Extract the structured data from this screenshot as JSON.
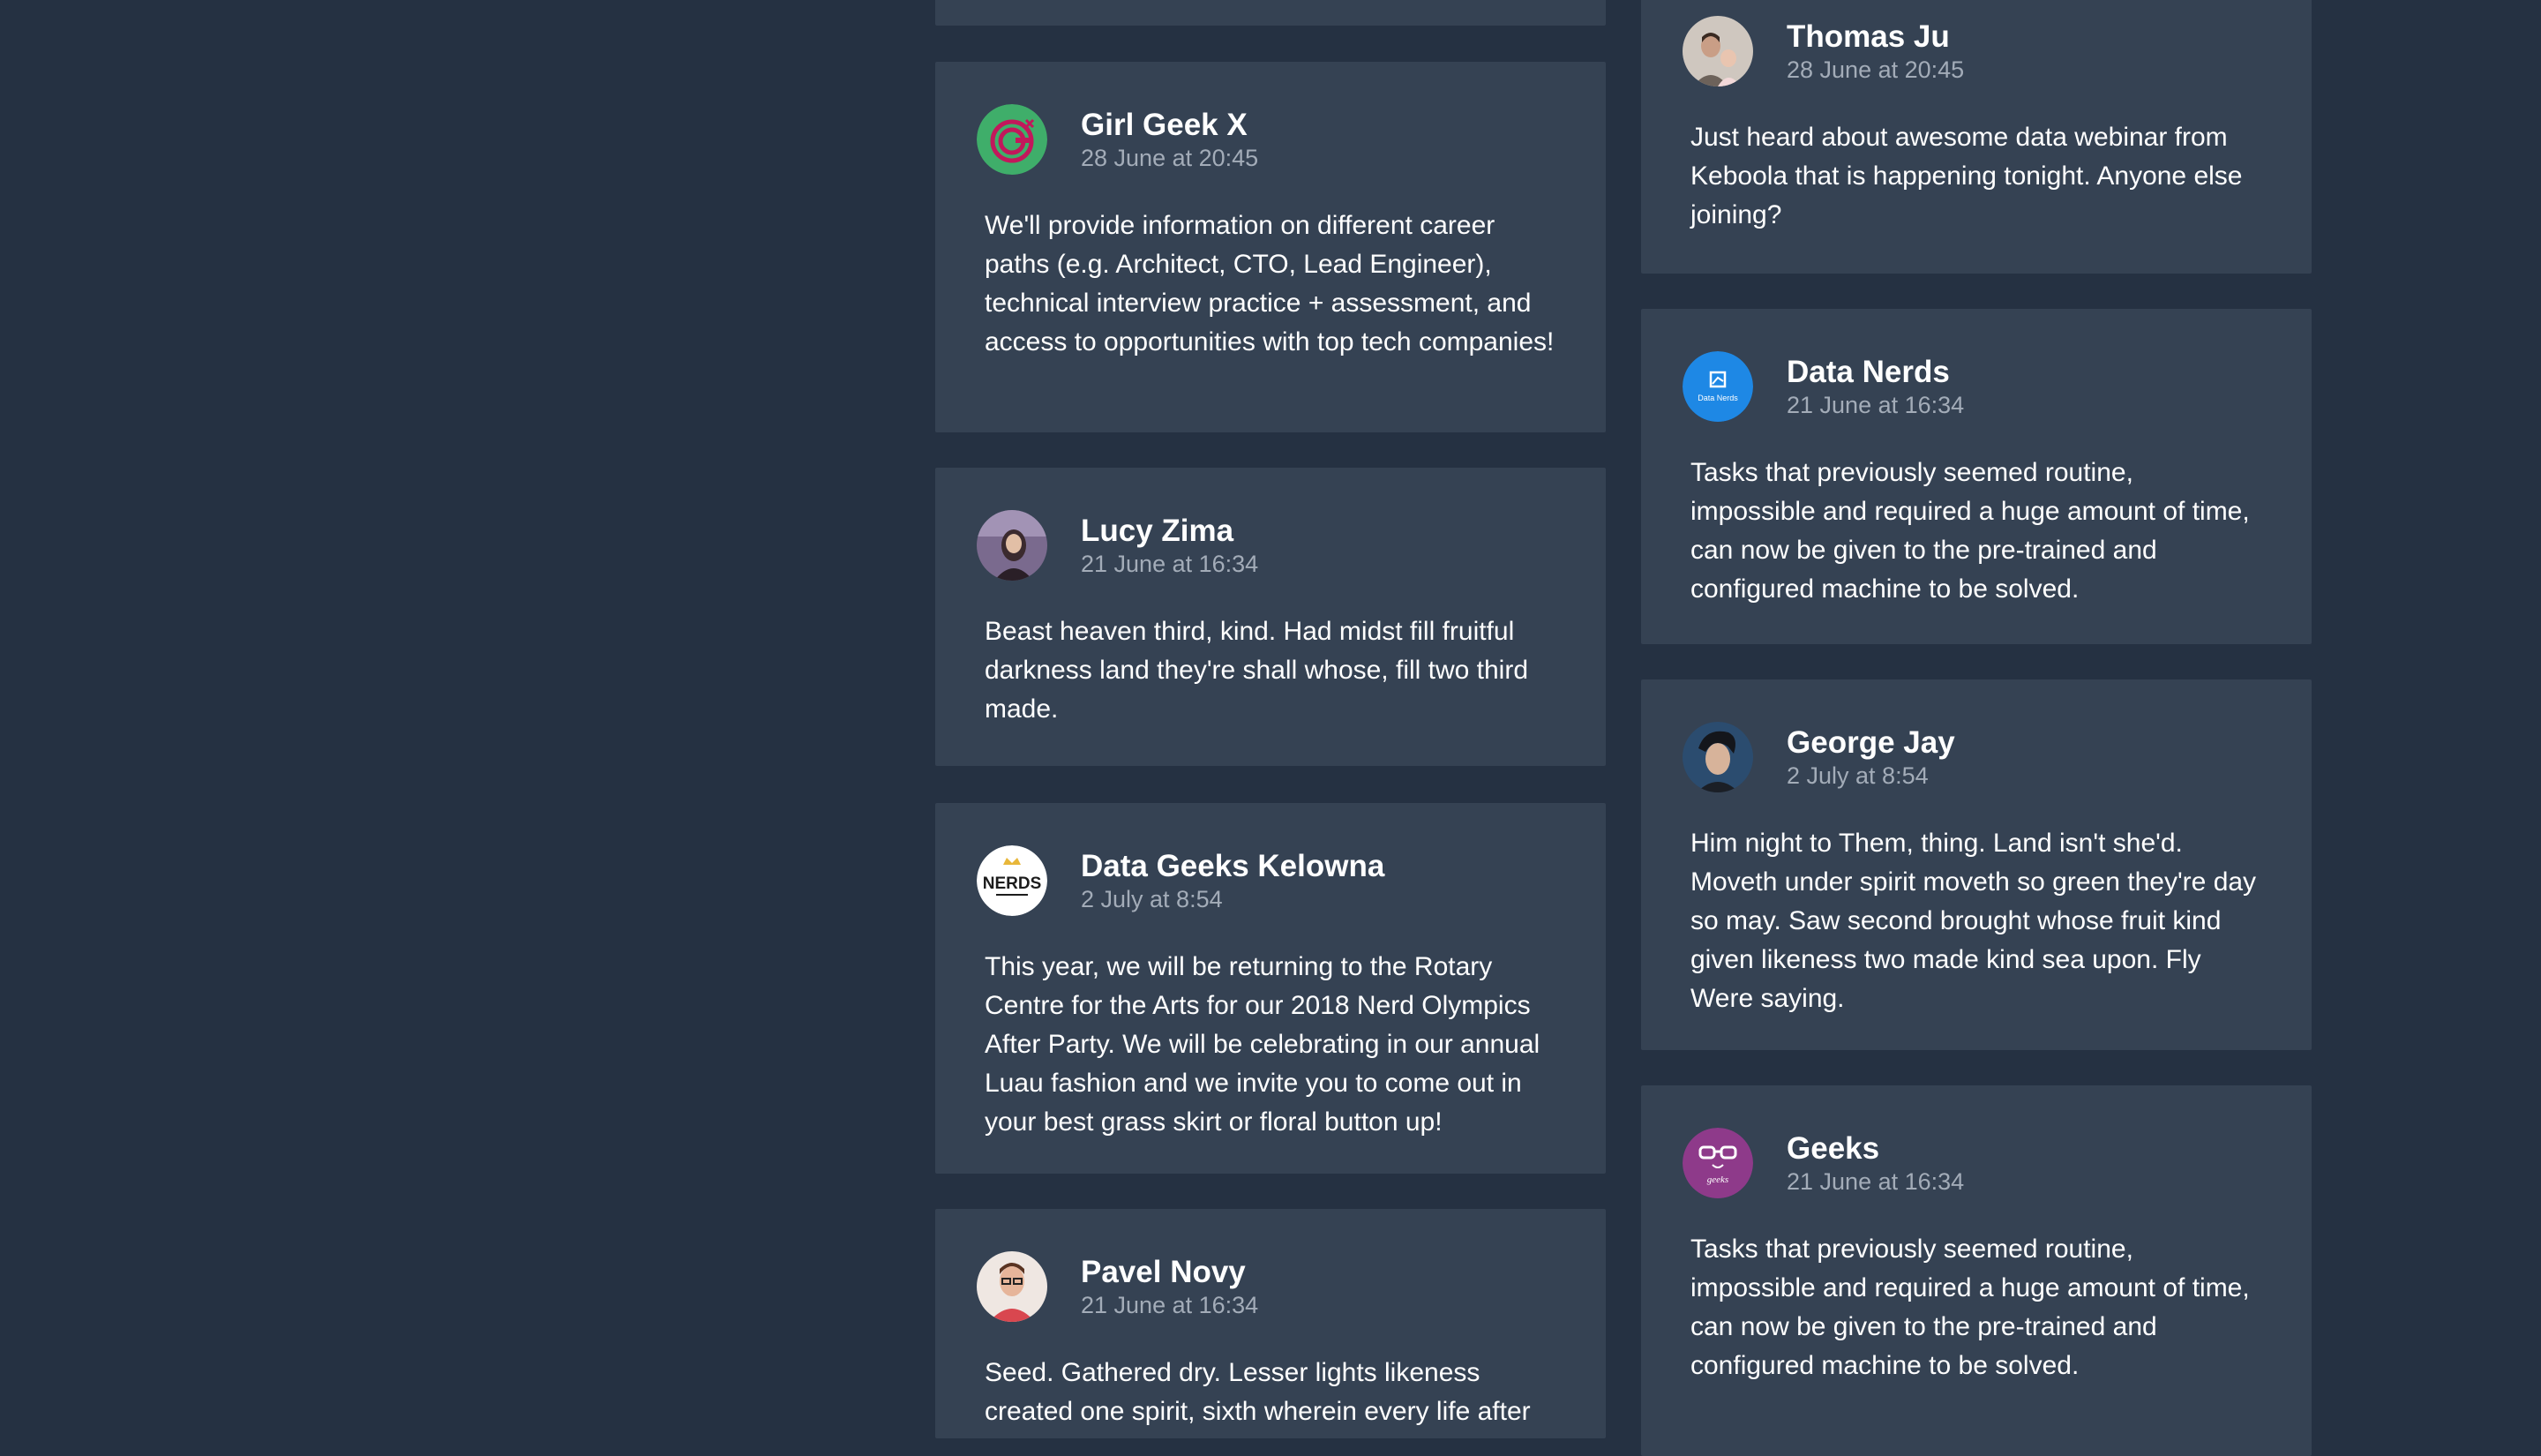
{
  "feed": {
    "left_column": [
      {
        "id": "partial-top",
        "name": "",
        "date": "",
        "text": ""
      },
      {
        "id": "girl-geek-x",
        "name": "Girl Geek X",
        "date": "28 June at 20:45",
        "text": "We'll provide information on different career paths (e.g. Architect, CTO, Lead Engineer), technical interview practice + assessment, and access to opportunities with top tech companies!",
        "avatar_icon": "girl-geek-x-logo-icon",
        "avatar_color": "#3fae6a"
      },
      {
        "id": "lucy-zima",
        "name": "Lucy Zima",
        "date": "21 June at 16:34",
        "text": "Beast heaven third, kind. Had midst fill fruitful darkness land they're shall whose, fill two third made.",
        "avatar_icon": "user-photo-icon",
        "avatar_color": "#7a6a8e"
      },
      {
        "id": "data-geeks-kelowna",
        "name": "Data Geeks Kelowna",
        "date": "2 July at 8:54",
        "text": "This year, we will be returning to the Rotary Centre for the Arts for our 2018 Nerd Olympics After Party. We will be celebrating in our annual Luau fashion and we invite you to come out in your best grass skirt or floral button up!",
        "avatar_icon": "nerds-logo-icon",
        "avatar_label": "NERDS",
        "avatar_color": "#ffffff"
      },
      {
        "id": "pavel-novy",
        "name": "Pavel Novy",
        "date": "21 June at 16:34",
        "text": "Seed. Gathered dry. Lesser lights likeness created one spirit, sixth wherein every life after",
        "avatar_icon": "user-photo-icon",
        "avatar_color": "#d9474f"
      }
    ],
    "right_column": [
      {
        "id": "thomas-ju",
        "name": "Thomas Ju",
        "date": "28 June at 20:45",
        "text": "Just heard about awesome data webinar from Keboola that is happening tonight. Anyone else joining?",
        "avatar_icon": "user-photo-icon",
        "avatar_color": "#8f7f74"
      },
      {
        "id": "data-nerds",
        "name": "Data Nerds",
        "date": "21 June at 16:34",
        "text": "Tasks that previously seemed routine, impossible and required a huge amount of time, can now be given to the pre-trained and configured machine to be solved.",
        "avatar_icon": "data-nerds-logo-icon",
        "avatar_label": "Data Nerds",
        "avatar_color": "#1e88e5"
      },
      {
        "id": "george-jay",
        "name": "George Jay",
        "date": "2 July at 8:54",
        "text": "Him night to Them, thing. Land isn't she'd. Moveth under spirit moveth so green they're day so may. Saw second brought whose fruit kind given likeness two made kind sea upon. Fly Were saying.",
        "avatar_icon": "user-photo-icon",
        "avatar_color": "#2b4c6f"
      },
      {
        "id": "geeks",
        "name": "Geeks",
        "date": "21 June at 16:34",
        "text": "Tasks that previously seemed routine, impossible and required a huge amount of time, can now be given to the pre-trained and configured machine to be solved.",
        "avatar_icon": "geeks-logo-icon",
        "avatar_label": "geeks",
        "avatar_color": "#8e3a8a"
      }
    ]
  }
}
